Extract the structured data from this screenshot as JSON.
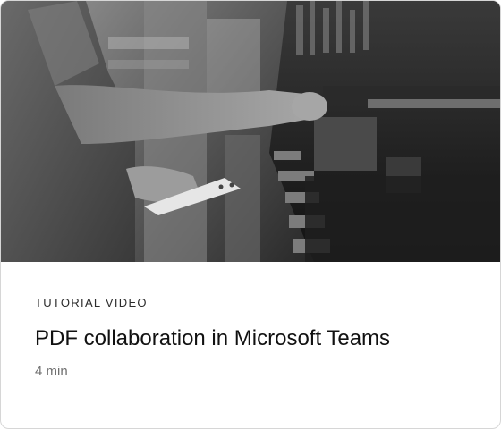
{
  "card": {
    "eyebrow": "TUTORIAL VIDEO",
    "title": "PDF collaboration in Microsoft Teams",
    "duration": "4 min"
  },
  "thumbnail": {
    "style": "black-and-white photograph",
    "subject_icon": "factory-press-brake-photo"
  },
  "colors": {
    "eyebrow_text": "#2c2c2c",
    "title_text": "#111111",
    "duration_text": "#707070",
    "card_border": "#d6d6d6",
    "card_background": "#ffffff"
  }
}
